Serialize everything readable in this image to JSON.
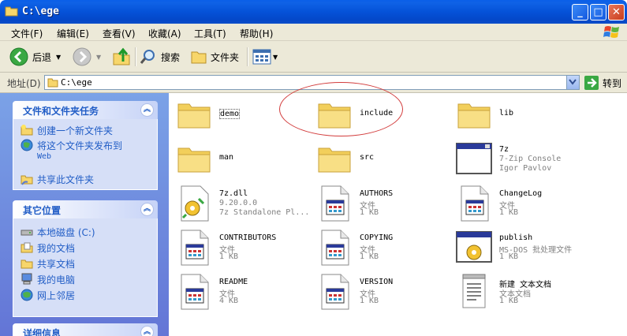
{
  "window": {
    "title": "C:\\ege"
  },
  "menu": {
    "items": [
      "文件(F)",
      "编辑(E)",
      "查看(V)",
      "收藏(A)",
      "工具(T)",
      "帮助(H)"
    ]
  },
  "toolbar": {
    "back_label": "后退",
    "search_label": "搜索",
    "folders_label": "文件夹"
  },
  "address": {
    "label": "地址(D)",
    "value": "C:\\ege",
    "go_label": "转到"
  },
  "sidebar": {
    "tasks": {
      "title": "文件和文件夹任务",
      "items": [
        {
          "label": "创建一个新文件夹",
          "icon": "new-folder-icon"
        },
        {
          "label": "将这个文件夹发布到",
          "label2": "Web",
          "icon": "publish-web-icon"
        },
        {
          "label": "共享此文件夹",
          "icon": "share-folder-icon"
        }
      ]
    },
    "places": {
      "title": "其它位置",
      "items": [
        {
          "label": "本地磁盘 (C:)",
          "icon": "local-disk-icon"
        },
        {
          "label": "我的文档",
          "icon": "my-documents-icon"
        },
        {
          "label": "共享文档",
          "icon": "shared-documents-icon"
        },
        {
          "label": "我的电脑",
          "icon": "my-computer-icon"
        },
        {
          "label": "网上邻居",
          "icon": "network-places-icon"
        }
      ]
    },
    "details": {
      "title": "详细信息"
    }
  },
  "files": [
    {
      "name": "demo",
      "kind": "folder",
      "line2": "",
      "line3": ""
    },
    {
      "name": "include",
      "kind": "folder",
      "line2": "",
      "line3": ""
    },
    {
      "name": "lib",
      "kind": "folder",
      "line2": "",
      "line3": ""
    },
    {
      "name": "man",
      "kind": "folder",
      "line2": "",
      "line3": ""
    },
    {
      "name": "src",
      "kind": "folder",
      "line2": "",
      "line3": ""
    },
    {
      "name": "7z",
      "kind": "app",
      "line2": "7-Zip Console",
      "line3": "Igor Pavlov"
    },
    {
      "name": "7z.dll",
      "kind": "dll",
      "line2": "9.20.0.0",
      "line3": "7z Standalone Pl..."
    },
    {
      "name": "AUTHORS",
      "kind": "file",
      "line2": "文件",
      "line3": "1 KB"
    },
    {
      "name": "ChangeLog",
      "kind": "file",
      "line2": "文件",
      "line3": "1 KB"
    },
    {
      "name": "CONTRIBUTORS",
      "kind": "file",
      "line2": "文件",
      "line3": "1 KB"
    },
    {
      "name": "COPYING",
      "kind": "file",
      "line2": "文件",
      "line3": "1 KB"
    },
    {
      "name": "publish",
      "kind": "batch",
      "line2": "MS-DOS 批处理文件",
      "line3": "1 KB"
    },
    {
      "name": "README",
      "kind": "file",
      "line2": "文件",
      "line3": "4 KB"
    },
    {
      "name": "VERSION",
      "kind": "file",
      "line2": "文件",
      "line3": "1 KB"
    },
    {
      "name": "新建 文本文档",
      "kind": "text",
      "line2": "文本文档",
      "line3": "1 KB"
    }
  ]
}
